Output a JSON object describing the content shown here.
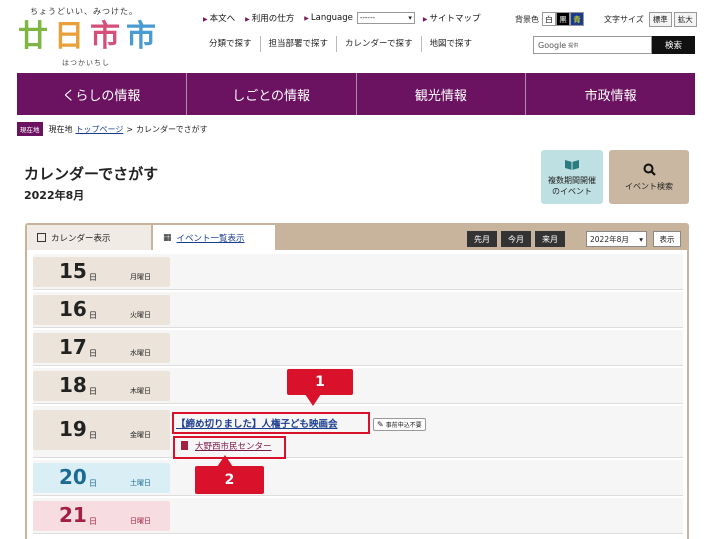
{
  "logo": {
    "tagline": "ちょうどいい、みつけた。",
    "chars": [
      "廿",
      "日",
      "市",
      "市"
    ],
    "char_colors": [
      "#7fb543",
      "#e8a13a",
      "#d4507a",
      "#4a9bd1"
    ],
    "ruby": "はつかいちし"
  },
  "toplinks": {
    "honbun": "本文へ",
    "usage": "利用の仕方",
    "language": "Language",
    "lang_value": "------",
    "sitemap": "サイトマップ"
  },
  "bg_color": {
    "label": "背景色",
    "options": [
      "白",
      "黒",
      "青"
    ]
  },
  "font_size": {
    "label": "文字サイズ",
    "options": [
      "標準",
      "拡大"
    ]
  },
  "subnav": [
    "分類で探す",
    "担当部署で探す",
    "カレンダーで探す",
    "地図で探す"
  ],
  "search": {
    "placeholder": "Google",
    "placeholder_small": "提供",
    "button": "検索"
  },
  "main_nav": [
    "くらしの情報",
    "しごとの情報",
    "観光情報",
    "市政情報"
  ],
  "breadcrumb": {
    "badge": "現在地",
    "prefix": "現在地",
    "top": "トップページ",
    "sep": ">",
    "current": "カレンダーでさがす"
  },
  "page": {
    "title": "カレンダーでさがす",
    "month": "2022年8月"
  },
  "tiles": {
    "multi_l1": "複数期間開催",
    "multi_l2": "のイベント",
    "search": "イベント検索"
  },
  "tabs": {
    "calendar": "カレンダー表示",
    "list": "イベント一覧表示"
  },
  "controls": {
    "prev": "先月",
    "this": "今月",
    "next": "来月",
    "month": "2022年8月",
    "show": "表示"
  },
  "days": [
    {
      "num": "15",
      "nichi": "日",
      "weekday": "月曜日",
      "type": "weekday"
    },
    {
      "num": "16",
      "nichi": "日",
      "weekday": "火曜日",
      "type": "weekday"
    },
    {
      "num": "17",
      "nichi": "日",
      "weekday": "水曜日",
      "type": "weekday"
    },
    {
      "num": "18",
      "nichi": "日",
      "weekday": "木曜日",
      "type": "weekday"
    },
    {
      "num": "19",
      "nichi": "日",
      "weekday": "金曜日",
      "type": "weekday"
    },
    {
      "num": "20",
      "nichi": "日",
      "weekday": "土曜日",
      "type": "sat"
    },
    {
      "num": "21",
      "nichi": "日",
      "weekday": "日曜日",
      "type": "sun"
    }
  ],
  "event": {
    "title": "【締め切りました】人権子ども映画会",
    "badge": "事前申込不要",
    "venue": "大野西市民センター"
  },
  "callouts": [
    "1",
    "2"
  ],
  "colors": {
    "accent": "#6b1361",
    "highlight": "#d9112a",
    "link": "#1a3c8f"
  }
}
